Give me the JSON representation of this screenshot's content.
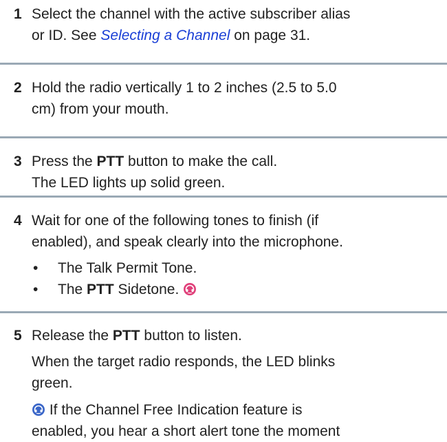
{
  "steps": [
    {
      "num": "1",
      "line1": "Select the channel with the active subscriber alias",
      "line2_pre": "or ID. See ",
      "link": "Selecting a Channel",
      "line2_post": " on page 31."
    },
    {
      "num": "2",
      "line1": "Hold the radio vertically 1 to 2 inches (2.5 to 5.0",
      "line2": "cm) from your mouth."
    },
    {
      "num": "3",
      "line1_pre": "Press the ",
      "bold": "PTT",
      "line1_post": " button to make the call.",
      "line2": "The LED lights up solid green."
    },
    {
      "num": "4",
      "line1": "Wait for one of the following tones to finish (if",
      "line2": "enabled), and speak clearly into the microphone.",
      "bullet1": "The Talk Permit Tone.",
      "bullet2_pre": "The ",
      "bullet2_bold": "PTT",
      "bullet2_post": " Sidetone."
    },
    {
      "num": "5",
      "line1_pre": "Release the ",
      "bold": "PTT",
      "line1_post": " button to listen.",
      "para1_l1": "When the target radio responds, the LED blinks",
      "para1_l2": "green.",
      "para2_l1": " If the Channel Free Indication feature is",
      "para2_l2": "enabled, you hear a short alert tone the moment"
    }
  ],
  "bullet_char": "•",
  "icon_colors": {
    "pink": "#e0407a",
    "blue": "#3a66c8"
  }
}
